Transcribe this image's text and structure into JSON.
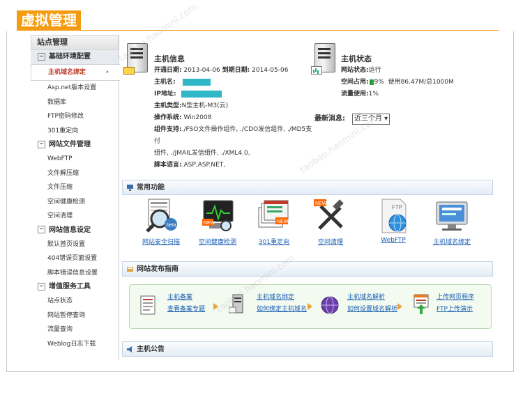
{
  "header": {
    "title": "虚拟管理"
  },
  "sidebar": {
    "title": "站点管理",
    "groups": [
      {
        "label": "基础环境配置",
        "toggle": "⊟",
        "items": [
          "主机域名绑定",
          "Asp.net版本设置",
          "数据库",
          "FTP密码修改",
          "301重定向"
        ]
      },
      {
        "label": "网站文件管理",
        "toggle": "⊟",
        "items": [
          "WebFTP",
          "文件解压缩",
          "文件压缩",
          "空间健康检测",
          "空间清理"
        ]
      },
      {
        "label": "网站信息设定",
        "toggle": "⊟",
        "items": [
          "默认首页设置",
          "404错误页面设置",
          "脚本错误信息设置"
        ]
      },
      {
        "label": "增值服务工具",
        "toggle": "⊟",
        "items": [
          "站点状态",
          "网站暂停查询",
          "流量查询",
          "Weblog日志下载"
        ]
      }
    ]
  },
  "host_info": {
    "title": "主机信息",
    "open_label": "开通日期:",
    "open_date": "2013-04-06",
    "expire_label": "到期日期:",
    "expire_date": "2014-05-06",
    "hostname_label": "主机名:",
    "ip_label": "IP地址:",
    "type_label": "主机类型:",
    "type_value": "N型主机-M3(云)",
    "os_label": "操作系统:",
    "os_value": "Win2008",
    "components_label": "组件支持:",
    "components_line1": "./FSO文件操作组件, ./CDO发信组件, ./MD5支付",
    "components_line2": "组件, ./JMAIL发信组件, ./XML4.0,",
    "script_label": "脚本语言:",
    "script_value": ".ASP,ASP.NET,"
  },
  "host_status": {
    "title": "主机状态",
    "status_label": "网站状态:",
    "status_value": "运行",
    "space_label": "空间占用:",
    "space_percent": "9%",
    "space_detail": "使用86.47M/总1000M",
    "traffic_label": "流量使用:",
    "traffic_value": "1%",
    "news_label": "最新消息:",
    "news_select": "近三个月"
  },
  "common": {
    "title": "常用功能",
    "items": [
      {
        "label": "网站安全扫描",
        "icon": "security-scan-icon"
      },
      {
        "label": "空间健康检测",
        "icon": "health-check-icon"
      },
      {
        "label": "301重定向",
        "icon": "redirect-icon"
      },
      {
        "label": "空间清理",
        "icon": "cleanup-tools-icon"
      },
      {
        "label": "WebFTP",
        "icon": "webftp-icon"
      },
      {
        "label": "主机域名绑定",
        "icon": "domain-bind-icon"
      }
    ]
  },
  "guide": {
    "title": "网站发布指南",
    "steps": [
      {
        "line1": "主机备案",
        "line2": "查看备案专题"
      },
      {
        "line1": "主机域名绑定",
        "line2": "如何绑定主机域名"
      },
      {
        "line1": "主机域名解析",
        "line2": "如何设置域名解析"
      },
      {
        "line1": "上传网页程序",
        "line2": "FTP上传演示"
      }
    ]
  },
  "notice": {
    "title": "主机公告"
  },
  "colors": {
    "accent": "#f39c12",
    "link": "#1a5fb4",
    "bar": "#2fb7c7"
  }
}
